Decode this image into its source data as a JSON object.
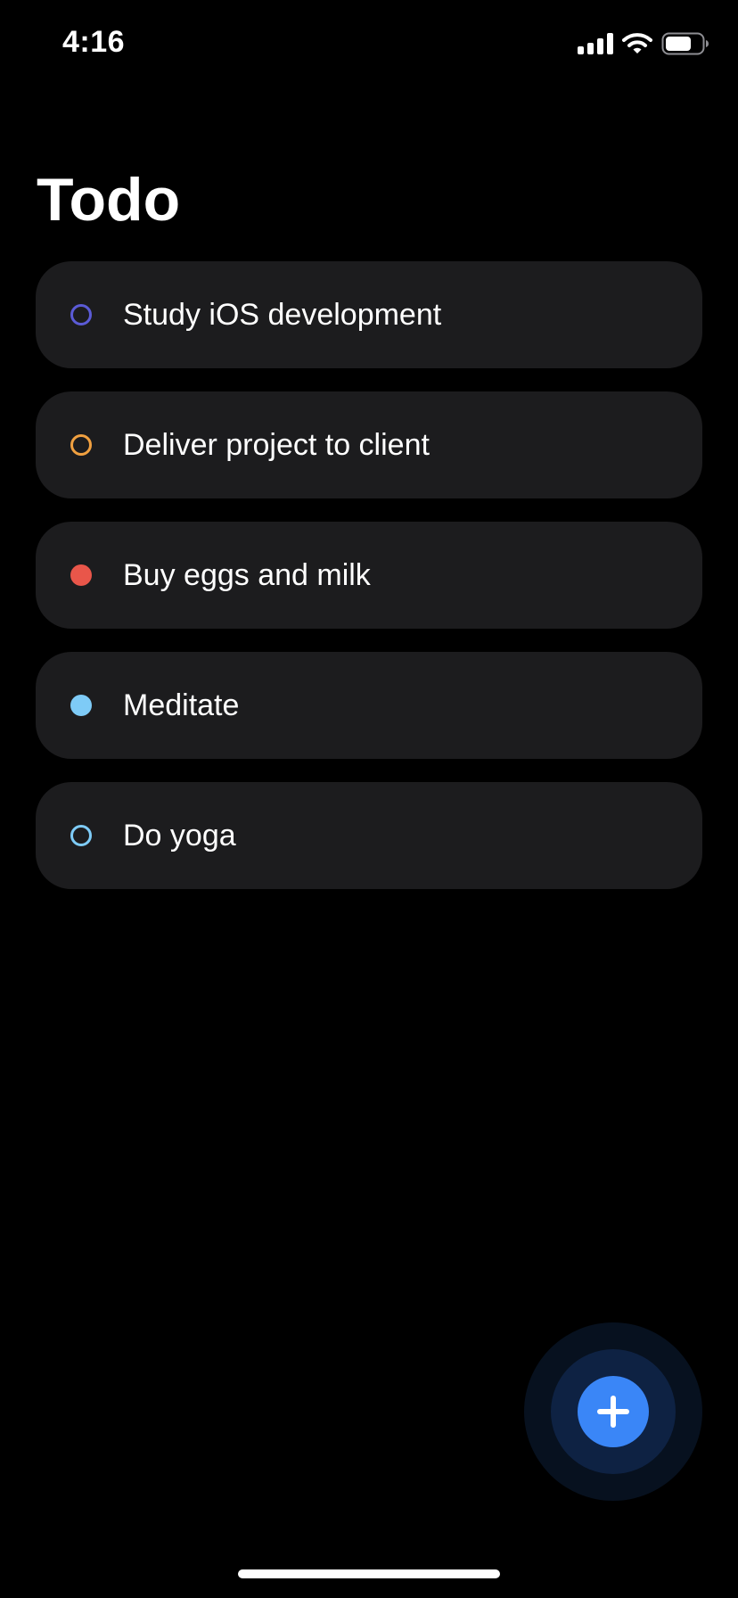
{
  "status_bar": {
    "time": "4:16",
    "icons": [
      "signal-icon",
      "wifi-icon",
      "battery-icon"
    ]
  },
  "header": {
    "title": "Todo"
  },
  "todos": [
    {
      "label": "Study iOS development",
      "marker_style": "hollow",
      "marker_color": "#5b5bd6"
    },
    {
      "label": "Deliver project to client",
      "marker_style": "hollow",
      "marker_color": "#f0a040"
    },
    {
      "label": "Buy eggs and milk",
      "marker_style": "filled",
      "marker_color": "#e9564a"
    },
    {
      "label": "Meditate",
      "marker_style": "filled",
      "marker_color": "#7ecbf7"
    },
    {
      "label": "Do yoga",
      "marker_style": "hollow",
      "marker_color": "#7ecbf7"
    }
  ],
  "fab": {
    "icon": "plus-icon",
    "color": "#3a86f7"
  },
  "colors": {
    "background": "#000000",
    "card": "#1c1c1e",
    "text": "#ffffff"
  }
}
